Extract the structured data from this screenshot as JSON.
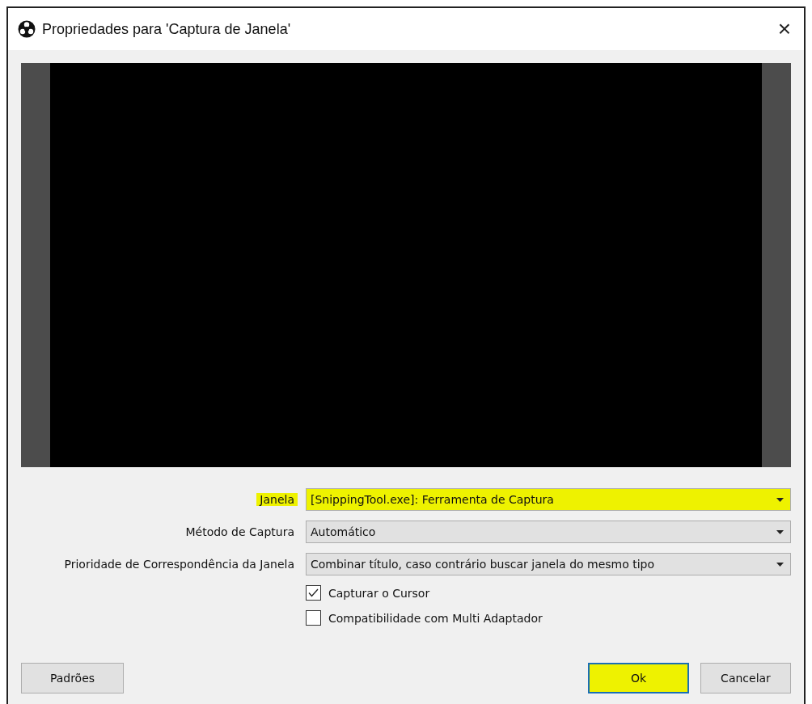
{
  "window": {
    "title": "Propriedades para 'Captura de Janela'",
    "close": "×"
  },
  "preview": {
    "kind": "empty"
  },
  "fields": [
    {
      "label": "Janela",
      "value": "[SnippingTool.exe]: Ferramenta de Captura",
      "highlighted": true
    },
    {
      "label": "Método de Captura",
      "value": "Automático",
      "highlighted": false
    },
    {
      "label": "Prioridade de Correspondência da Janela",
      "value": "Combinar título, caso contrário buscar janela do mesmo tipo",
      "highlighted": false
    }
  ],
  "checkboxes": [
    {
      "label": "Capturar o Cursor",
      "checked": true
    },
    {
      "label": "Compatibilidade com Multi Adaptador",
      "checked": false
    }
  ],
  "buttons": {
    "left": [
      {
        "label": "Padrões",
        "highlighted": false
      }
    ],
    "right": [
      {
        "label": "Ok",
        "highlighted": true,
        "focused": true
      },
      {
        "label": "Cancelar",
        "highlighted": false,
        "focused": false
      }
    ]
  }
}
